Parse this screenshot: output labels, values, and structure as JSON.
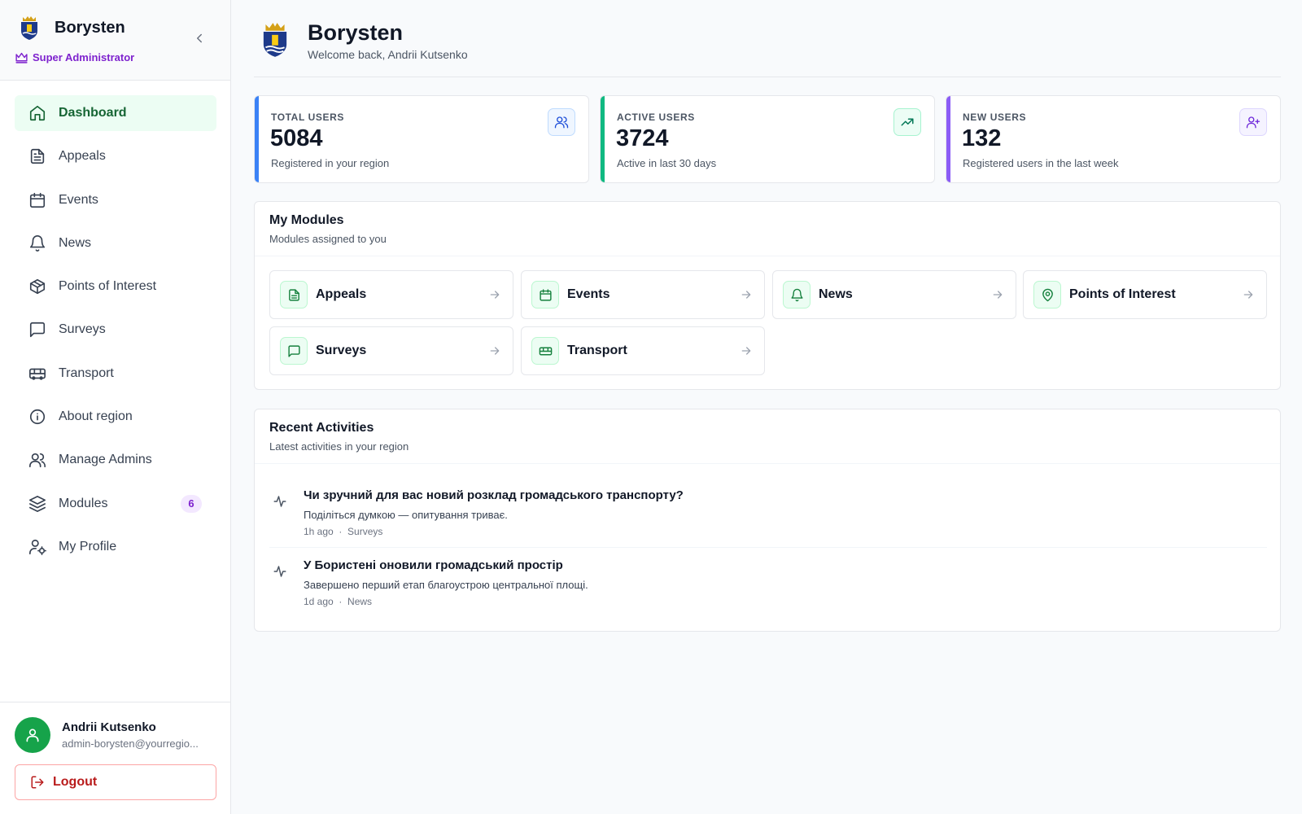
{
  "sidebar": {
    "title": "Borysten",
    "role": "Super Administrator",
    "nav": [
      {
        "label": "Dashboard",
        "icon": "home-icon",
        "active": true
      },
      {
        "label": "Appeals",
        "icon": "document-icon"
      },
      {
        "label": "Events",
        "icon": "calendar-icon"
      },
      {
        "label": "News",
        "icon": "bell-icon"
      },
      {
        "label": "Points of Interest",
        "icon": "box-icon"
      },
      {
        "label": "Surveys",
        "icon": "message-icon"
      },
      {
        "label": "Transport",
        "icon": "bus-icon"
      },
      {
        "label": "About region",
        "icon": "info-icon"
      },
      {
        "label": "Manage Admins",
        "icon": "users-icon"
      },
      {
        "label": "Modules",
        "icon": "layers-icon",
        "badge": "6"
      },
      {
        "label": "My Profile",
        "icon": "user-cog-icon"
      }
    ],
    "user": {
      "name": "Andrii Kutsenko",
      "email": "admin-borysten@yourregio..."
    },
    "logout_label": "Logout"
  },
  "header": {
    "title": "Borysten",
    "subtitle": "Welcome back, Andrii Kutsenko"
  },
  "stats": [
    {
      "label": "TOTAL USERS",
      "value": "5084",
      "desc": "Registered in your region",
      "accent": "#3b82f6",
      "icon": "users-icon"
    },
    {
      "label": "ACTIVE USERS",
      "value": "3724",
      "desc": "Active in last 30 days",
      "accent": "#10b981",
      "icon": "trending-up-icon"
    },
    {
      "label": "NEW USERS",
      "value": "132",
      "desc": "Registered users in the last week",
      "accent": "#8b5cf6",
      "icon": "user-plus-icon"
    }
  ],
  "modules": {
    "title": "My Modules",
    "subtitle": "Modules assigned to you",
    "items": [
      {
        "label": "Appeals",
        "icon": "document-icon"
      },
      {
        "label": "Events",
        "icon": "calendar-icon"
      },
      {
        "label": "News",
        "icon": "bell-icon"
      },
      {
        "label": "Points of Interest",
        "icon": "map-pin-icon"
      },
      {
        "label": "Surveys",
        "icon": "message-icon"
      },
      {
        "label": "Transport",
        "icon": "bus-icon"
      }
    ]
  },
  "activities": {
    "title": "Recent Activities",
    "subtitle": "Latest activities in your region",
    "items": [
      {
        "title": "Чи зручний для вас новий розклад громадського транспорту?",
        "desc": "Поділіться думкою — опитування триває.",
        "time": "1h ago",
        "category": "Surveys"
      },
      {
        "title": "У Бористені оновили громадський простір",
        "desc": "Завершено перший етап благоустрою центральної площі.",
        "time": "1d ago",
        "category": "News"
      }
    ]
  },
  "colors": {
    "primary": "#16a34a",
    "role": "#7e22ce",
    "danger": "#b91c1c"
  }
}
